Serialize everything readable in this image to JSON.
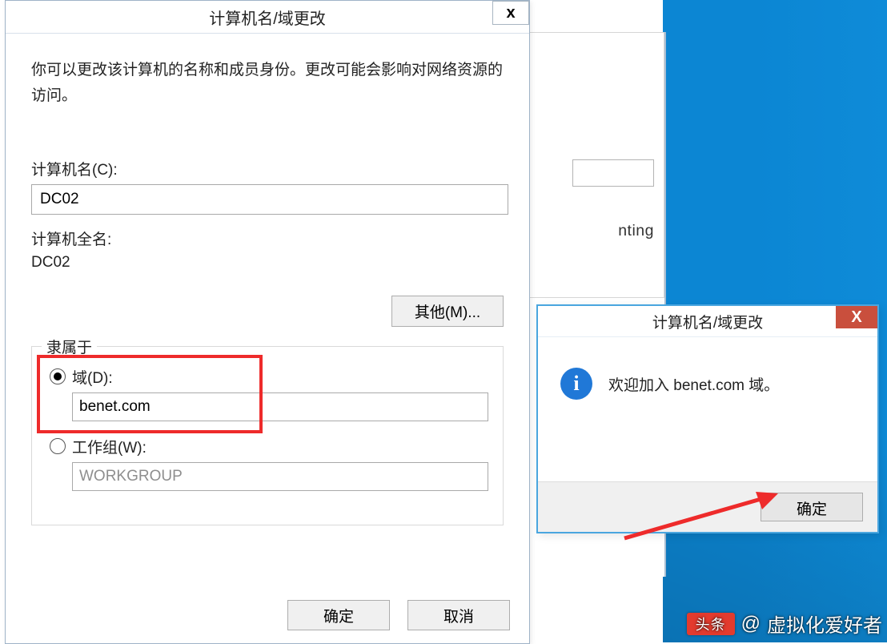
{
  "main_dialog": {
    "title": "计算机名/域更改",
    "close_glyph": "x",
    "description": "你可以更改该计算机的名称和成员身份。更改可能会影响对网络资源的访问。",
    "computer_name_label": "计算机名(C):",
    "computer_name_value": "DC02",
    "full_name_label": "计算机全名:",
    "full_name_value": "DC02",
    "more_button": "其他(M)...",
    "member_of": {
      "legend": "隶属于",
      "domain_label": "域(D):",
      "domain_value": "benet.com",
      "domain_selected": true,
      "workgroup_label": "工作组(W):",
      "workgroup_value": "WORKGROUP",
      "workgroup_selected": false
    },
    "ok_button": "确定",
    "cancel_button": "取消"
  },
  "parent_window": {
    "visible_text": "nting"
  },
  "confirm_dialog": {
    "title": "计算机名/域更改",
    "close_glyph": "X",
    "info_glyph": "i",
    "message": "欢迎加入 benet.com 域。",
    "ok_button": "确定"
  },
  "watermark": {
    "logo_text": "头条",
    "author_prefix": "@",
    "author": "虚拟化爱好者"
  }
}
